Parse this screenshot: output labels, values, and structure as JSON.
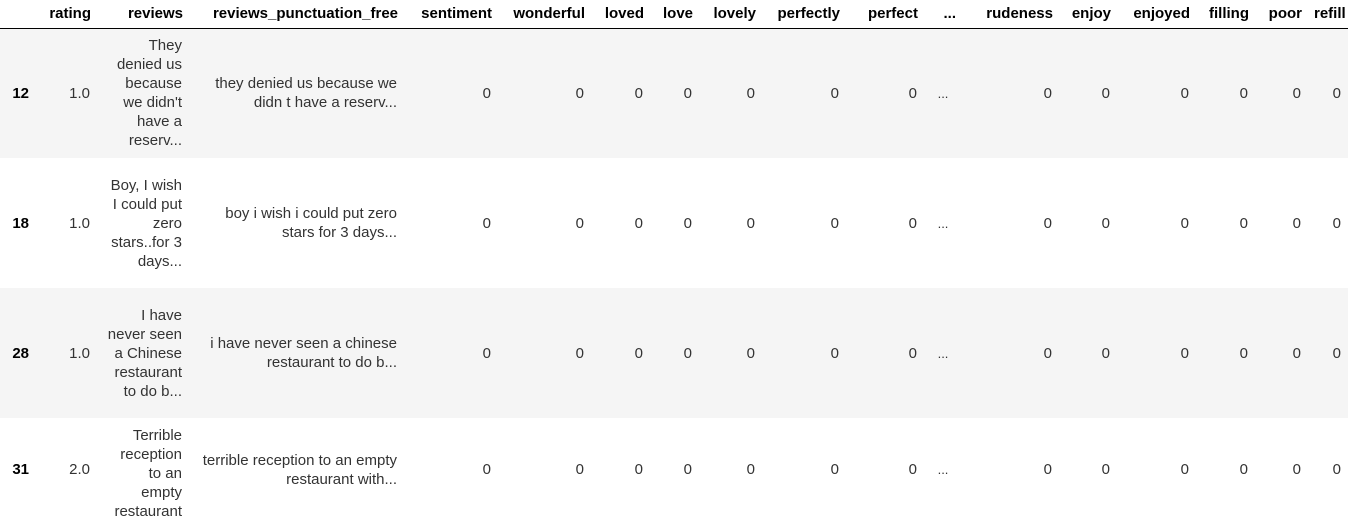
{
  "table": {
    "columns": [
      "",
      "rating",
      "reviews",
      "reviews_punctuation_free",
      "sentiment",
      "wonderful",
      "loved",
      "love",
      "lovely",
      "perfectly",
      "perfect",
      "...",
      "rudeness",
      "enjoy",
      "enjoyed",
      "filling",
      "poor",
      "refill"
    ],
    "rows": [
      {
        "index": "12",
        "cells": [
          "1.0",
          "They denied us because we didn't have a reserv...",
          "they denied us because we didn t have a reserv...",
          "0",
          "0",
          "0",
          "0",
          "0",
          "0",
          "0",
          "...",
          "0",
          "0",
          "0",
          "0",
          "0",
          "0"
        ]
      },
      {
        "index": "18",
        "cells": [
          "1.0",
          "Boy, I wish I could put zero stars..for 3 days...",
          "boy i wish i could put zero stars for 3 days...",
          "0",
          "0",
          "0",
          "0",
          "0",
          "0",
          "0",
          "...",
          "0",
          "0",
          "0",
          "0",
          "0",
          "0"
        ]
      },
      {
        "index": "28",
        "cells": [
          "1.0",
          "I have never seen a Chinese restaurant to do b...",
          "i have never seen a chinese restaurant to do b...",
          "0",
          "0",
          "0",
          "0",
          "0",
          "0",
          "0",
          "...",
          "0",
          "0",
          "0",
          "0",
          "0",
          "0"
        ]
      },
      {
        "index": "31",
        "cells": [
          "2.0",
          "Terrible reception to an empty restaurant",
          "terrible reception to an empty restaurant with...",
          "0",
          "0",
          "0",
          "0",
          "0",
          "0",
          "0",
          "...",
          "0",
          "0",
          "0",
          "0",
          "0",
          "0"
        ]
      }
    ]
  }
}
